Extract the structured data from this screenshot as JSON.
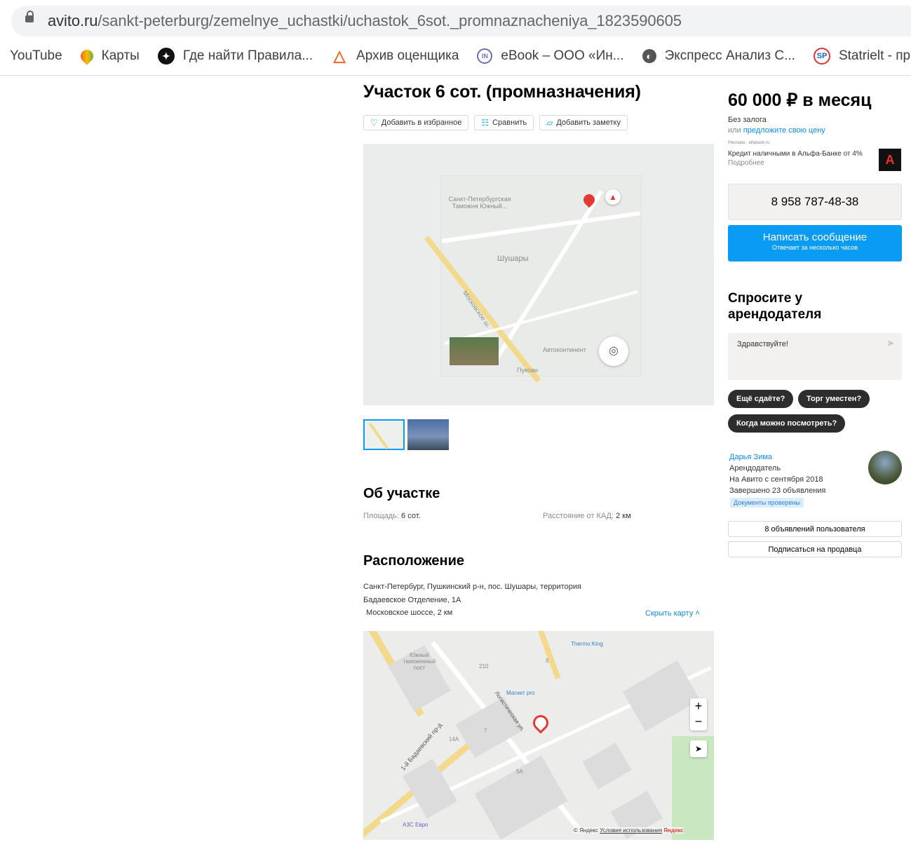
{
  "browser": {
    "url_host": "avito.ru",
    "url_path": "/sankt-peterburg/zemelnye_uchastki/uchastok_6sot._promnaznacheniya_1823590605",
    "bookmarks": [
      {
        "label": "YouTube"
      },
      {
        "label": "Карты"
      },
      {
        "label": "Где найти Правила..."
      },
      {
        "label": "Архив оценщика"
      },
      {
        "label": "eBook – ООО «Ин..."
      },
      {
        "label": "Экспресс Анализ С..."
      },
      {
        "label": "Statrielt - про"
      }
    ]
  },
  "listing": {
    "title": "Участок 6 сот. (промназначения)",
    "actions": {
      "favorite": "Добавить в избранное",
      "compare": "Сравнить",
      "note": "Добавить заметку"
    },
    "gallery_map_labels": {
      "customs": "Санкт-Петербургская Таможня Южный...",
      "shushary": "Шушары",
      "moscow_hw": "Московское ш.",
      "autocontinent": "Автоконтинент",
      "pukoan": "Пукоан"
    },
    "about": {
      "heading": "Об участке",
      "area_label": "Площадь:",
      "area_value": "6 сот.",
      "kad_label": "Расстояние от КАД:",
      "kad_value": "2 км"
    },
    "location": {
      "heading": "Расположение",
      "address_line1": "Санкт-Петербург, Пушкинский р-н, пос. Шушары, территория",
      "address_line2": "Бадаевское Отделение, 1А",
      "highway": "Московское шоссе, 2 км",
      "hide_map": "Скрыть карту",
      "map_labels": {
        "customs_post": "Южный таможенный пост",
        "thermo_king": "Thermo King",
        "magnit": "Магнит pro",
        "badaevsky": "1-й Бадаевский пр-д",
        "logistic": "Логистическая ул.",
        "azs": "АЗС Евро",
        "b210": "210",
        "b7": "7",
        "b5a": "5А",
        "b8": "8",
        "b14a": "14А",
        "copyright": "© Яндекс",
        "terms": "Условия использования",
        "yandex": "Яндекс"
      }
    }
  },
  "sidebar": {
    "price": "60 000 ₽ в месяц",
    "deposit": "Без залога",
    "offer_prefix": "или",
    "offer_link": "предложите свою цену",
    "ad_label": "Реклама · alfabank.ru",
    "ad_text": "Кредит наличными в Альфа-Банке от 4%",
    "ad_more": "Подробнее",
    "phone": "8 958 787-48-38",
    "write_title": "Написать сообщение",
    "write_sub": "Отвечает за несколько часов",
    "ask_heading_1": "Спросите у",
    "ask_heading_2": "арендодателя",
    "message_placeholder": "Здравствуйте!",
    "quick_replies": [
      "Ещё сдаёте?",
      "Торг уместен?",
      "Когда можно посмотреть?"
    ],
    "seller": {
      "name": "Дарья Зима",
      "role": "Арендодатель",
      "since": "На Авито с сентября 2018",
      "completed": "Завершено 23 объявления",
      "verified": "Документы проверены"
    },
    "user_ads": "8 объявлений пользователя",
    "subscribe": "Подписаться на продавца"
  },
  "colors": {
    "accent": "#0a9cf5",
    "link": "#0a8ee8",
    "pin": "#e53935"
  }
}
